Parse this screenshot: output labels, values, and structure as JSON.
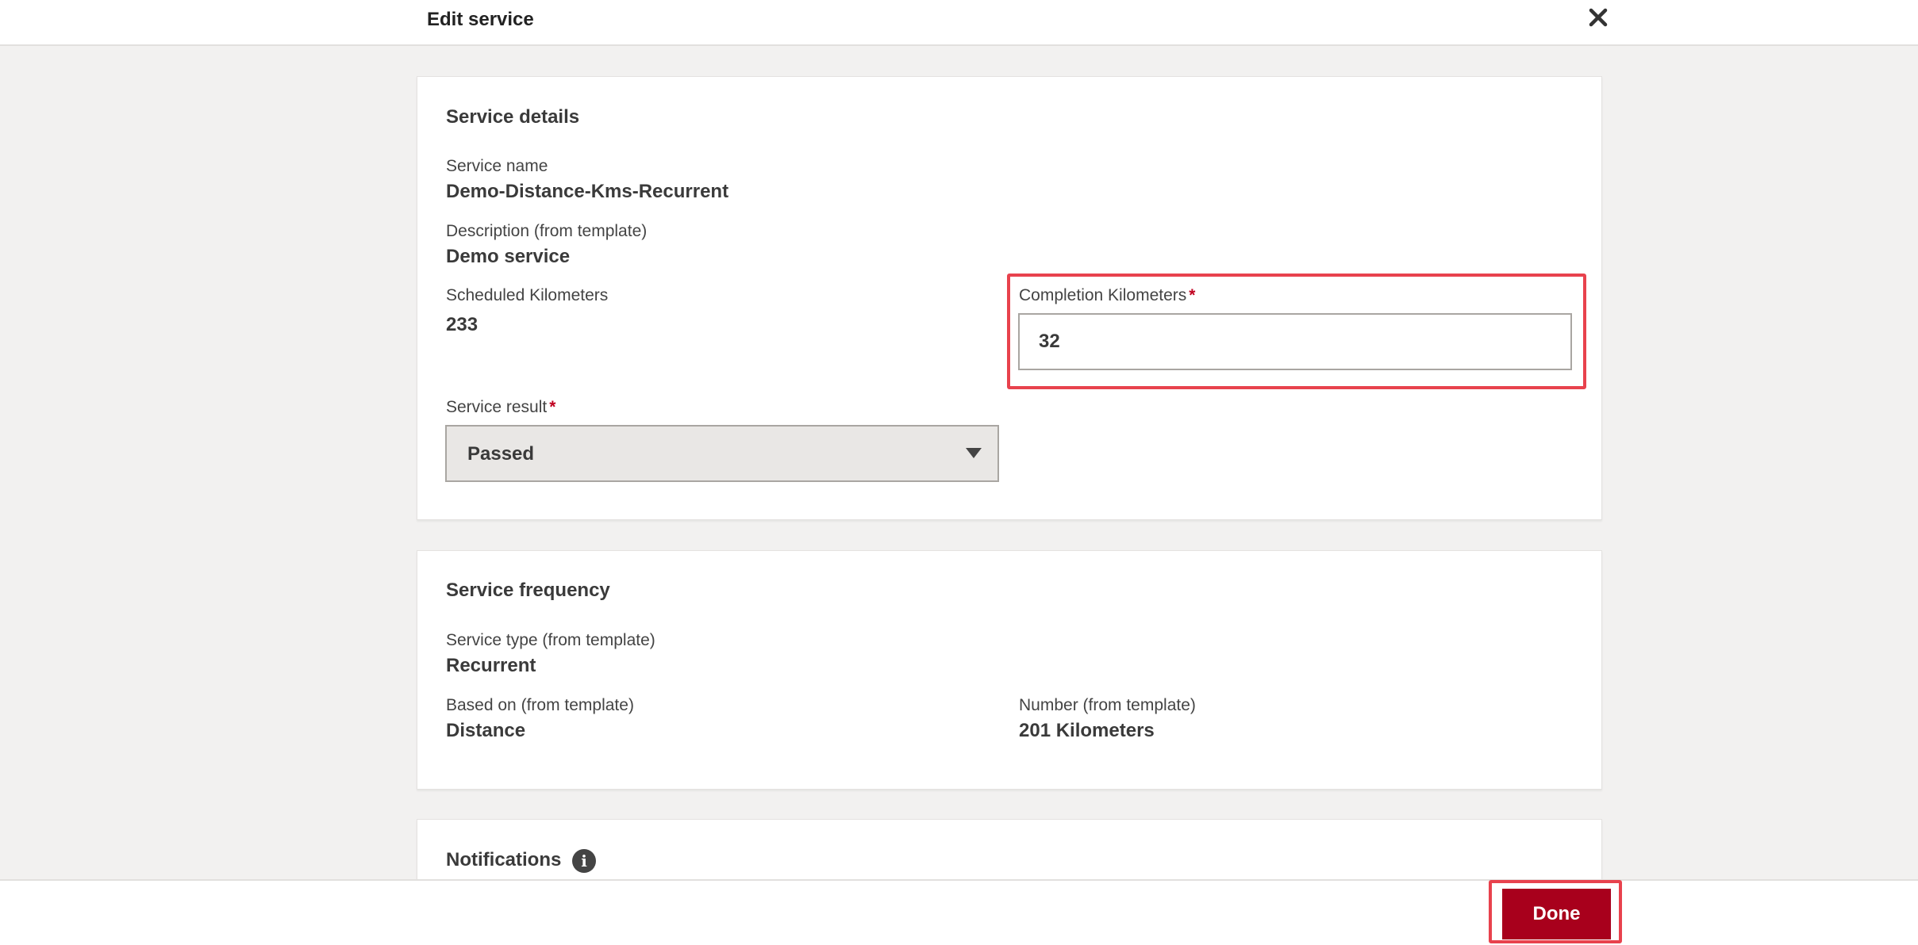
{
  "header": {
    "title": "Edit service",
    "close_icon": "close-icon"
  },
  "service_details": {
    "title": "Service details",
    "service_name_label": "Service name",
    "service_name_value": "Demo-Distance-Kms-Recurrent",
    "description_label": "Description (from template)",
    "description_value": "Demo service",
    "scheduled_km_label": "Scheduled Kilometers",
    "scheduled_km_value": "233",
    "completion_km_label": "Completion Kilometers",
    "completion_km_value": "32",
    "required_mark": "*",
    "service_result_label": "Service result",
    "service_result_value": "Passed"
  },
  "service_frequency": {
    "title": "Service frequency",
    "service_type_label": "Service type (from template)",
    "service_type_value": "Recurrent",
    "based_on_label": "Based on (from template)",
    "based_on_value": "Distance",
    "number_label": "Number (from template)",
    "number_value": "201 Kilometers"
  },
  "notifications": {
    "title": "Notifications",
    "info_icon": "info-icon",
    "info_glyph": "i"
  },
  "footer": {
    "done_label": "Done"
  },
  "colors": {
    "accent": "#a8001c",
    "highlight": "#e8424d",
    "background": "#f2f1f0"
  }
}
